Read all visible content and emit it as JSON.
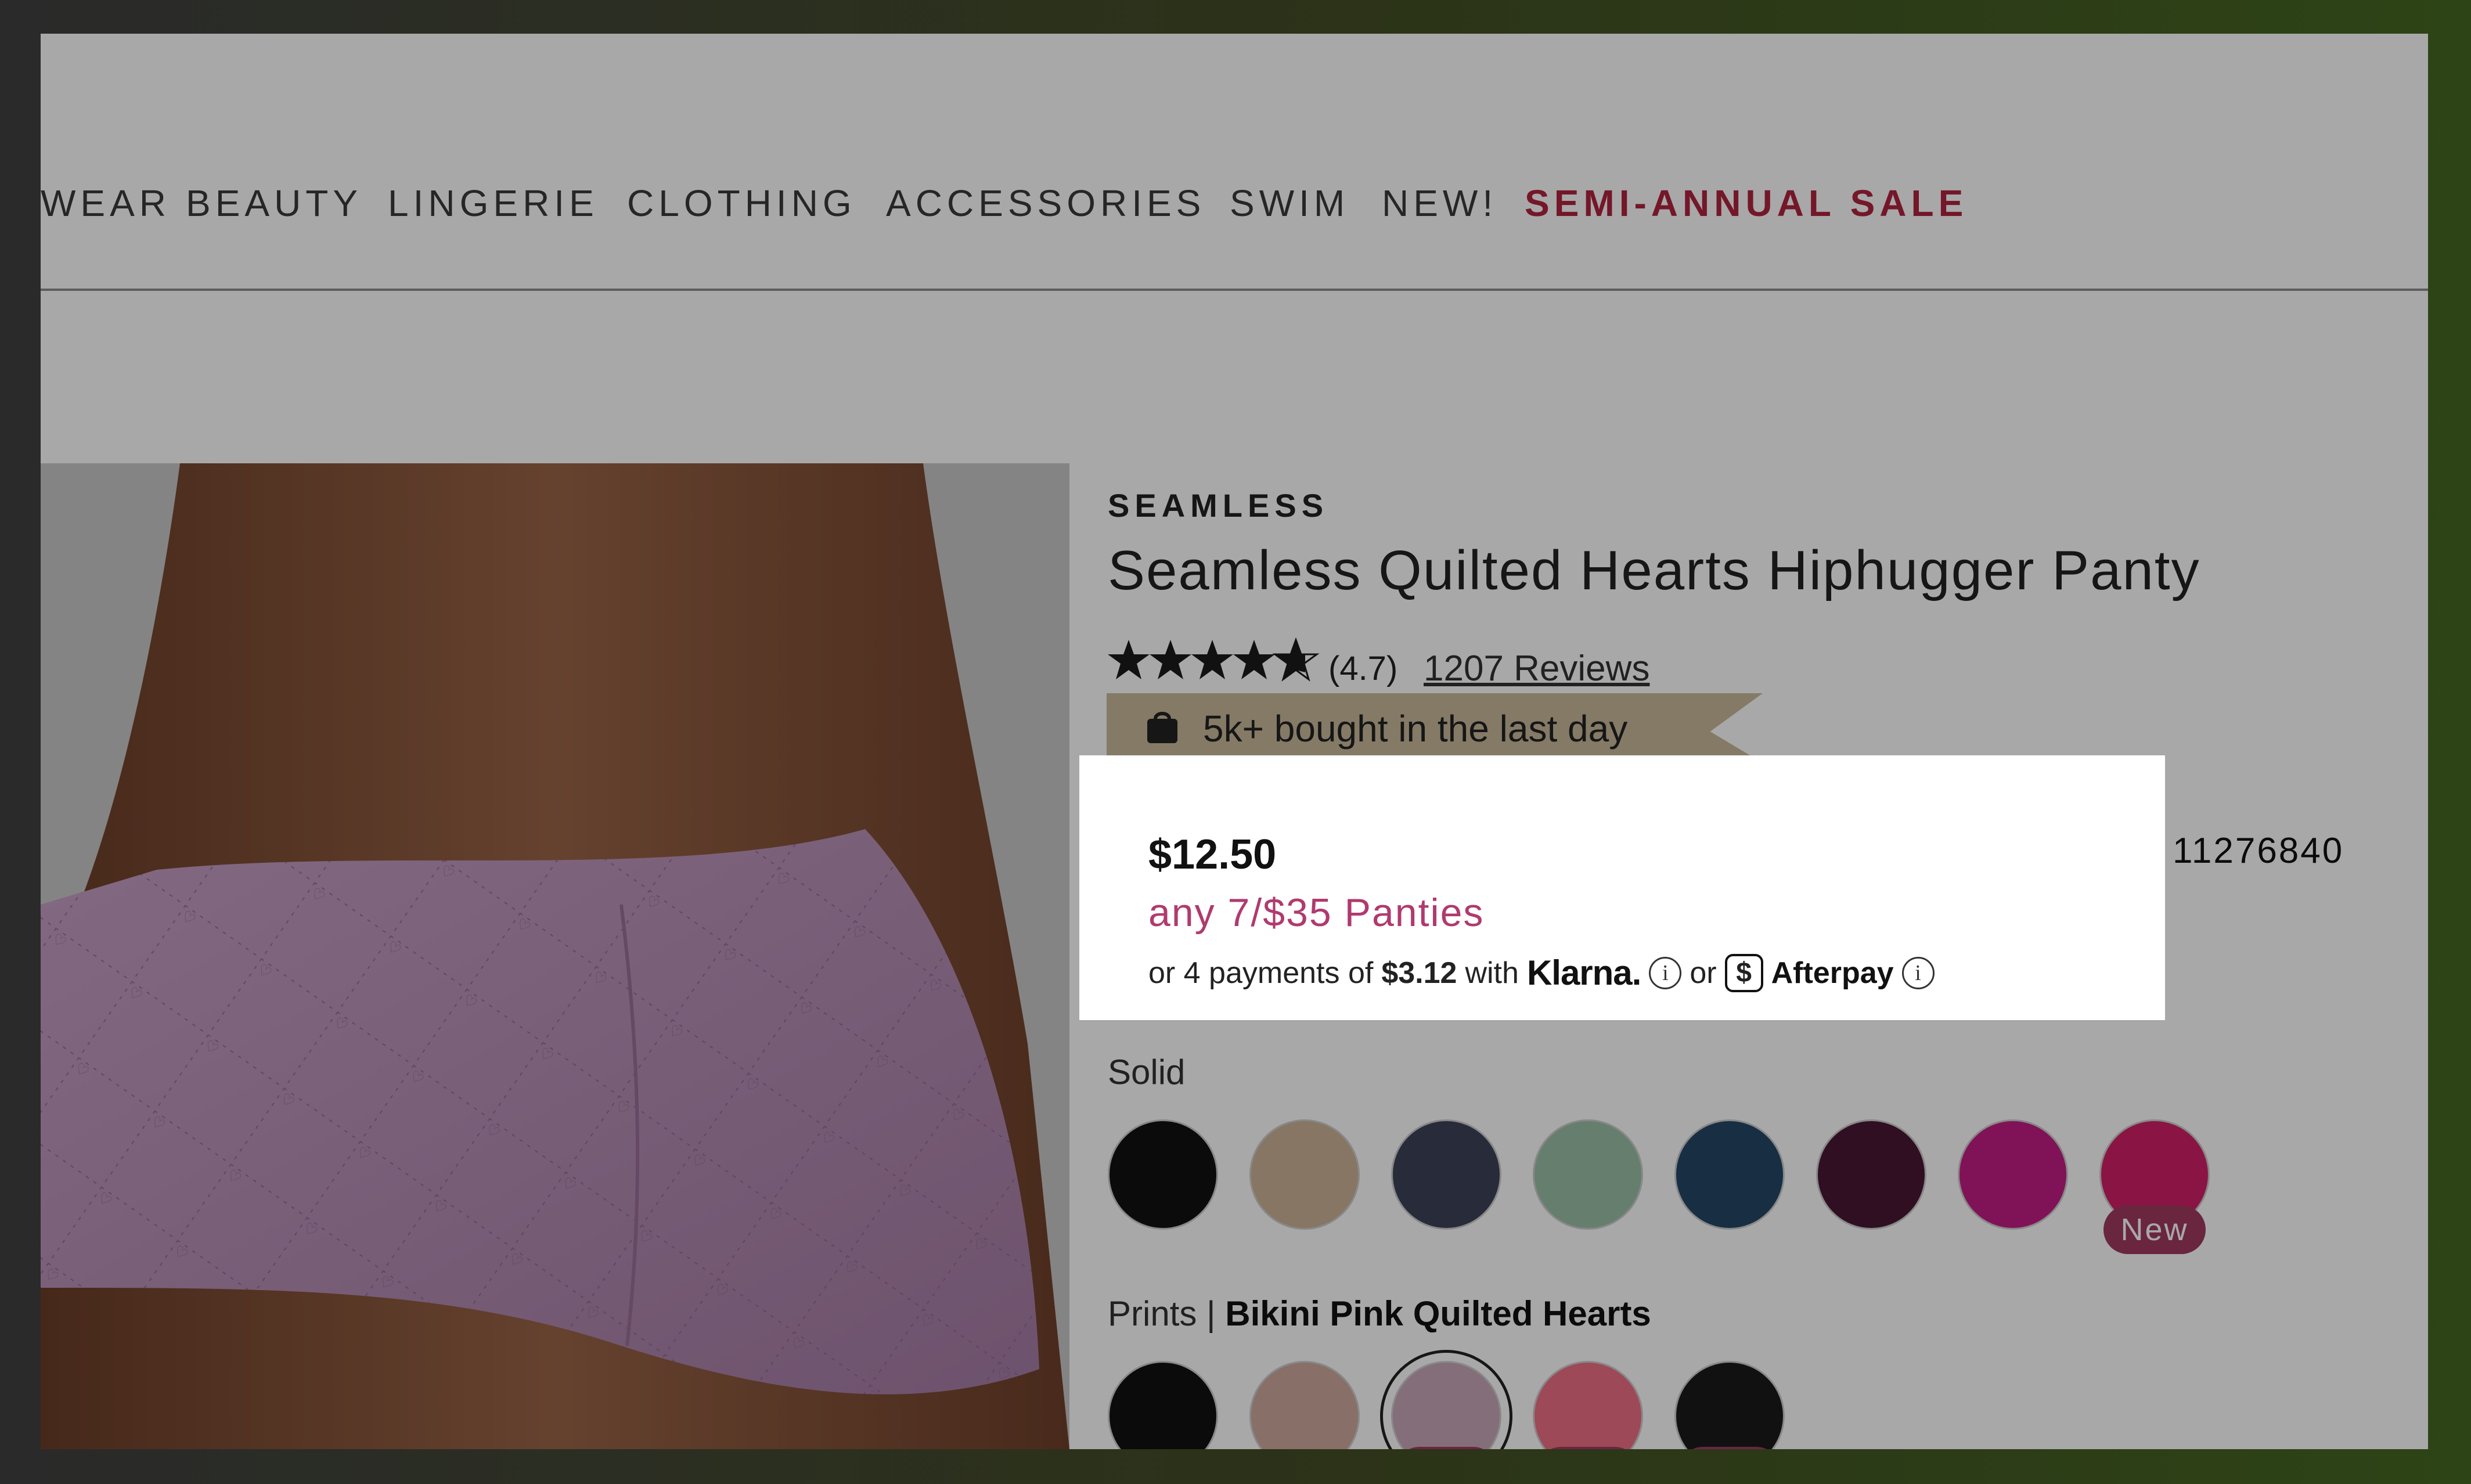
{
  "nav": {
    "items": [
      "WEAR",
      "BEAUTY",
      "LINGERIE",
      "CLOTHING",
      "ACCESSORIES",
      "SWIM",
      "NEW!"
    ],
    "sale_label": "SEMI-ANNUAL SALE"
  },
  "product": {
    "category": "SEAMLESS",
    "title": "Seamless Quilted Hearts Hiphugger Panty",
    "rating_value": 4.7,
    "rating_text": "(4.7)",
    "reviews_text": "1207 Reviews",
    "social_proof": "5k+ bought in the last day",
    "item_number": "11276840"
  },
  "pricing": {
    "price": "$12.50",
    "promo": "any 7/$35 Panties",
    "installment_prefix": "or 4 payments of",
    "installment_amount": "$3.12",
    "installment_with": "with",
    "klarna_label": "Klarna.",
    "or_label": "or",
    "afterpay_label": "Afterpay",
    "afterpay_badge_symbol": "$",
    "info_symbol": "i"
  },
  "colors": {
    "solid_label": "Solid",
    "solid_swatches": [
      {
        "color": "#111111",
        "badge": ""
      },
      {
        "color": "#cdb497",
        "badge": ""
      },
      {
        "color": "#3e4258",
        "badge": ""
      },
      {
        "color": "#9cc0a7",
        "badge": ""
      },
      {
        "color": "#244667",
        "badge": ""
      },
      {
        "color": "#4a1735",
        "badge": ""
      },
      {
        "color": "#c21d84",
        "badge": ""
      },
      {
        "color": "#d22168",
        "badge": "New"
      }
    ],
    "prints_label": "Prints |",
    "prints_selected": "Bikini Pink Quilted Hearts",
    "print_swatches": [
      {
        "color": "#121212",
        "badge": "",
        "selected": false
      },
      {
        "color": "#cfa99e",
        "badge": "",
        "selected": false
      },
      {
        "color": "#c9a7b8",
        "badge": "New",
        "selected": true
      },
      {
        "color": "#ef6f86",
        "badge": "New",
        "selected": false
      },
      {
        "color": "#1a1a1a",
        "badge": "New",
        "selected": false
      }
    ]
  },
  "theme": {
    "sale_color": "#b0233f",
    "promo_color": "#b03a6e",
    "new_badge_color": "#a13b60"
  }
}
